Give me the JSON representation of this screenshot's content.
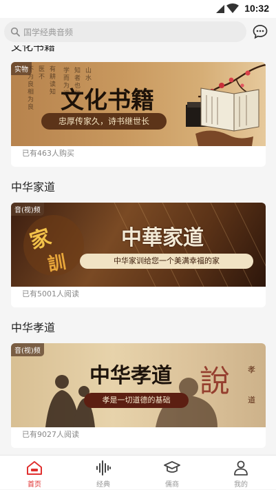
{
  "status_bar": {
    "time": "10:32"
  },
  "search": {
    "placeholder": "国学经典音频"
  },
  "partial_section_title": "文化书籍",
  "cards": [
    {
      "tag": "实物",
      "banner_title": "文化书籍",
      "banner_slogan": "忠厚传家久，诗书继世长",
      "footer": "已有463人购买"
    },
    {
      "section_title": "中华家道",
      "tag": "音(视)频",
      "banner_title": "中華家道",
      "banner_slogan": "中华家训给您一个美满幸福的家",
      "footer": "已有5001人阅读"
    },
    {
      "section_title": "中华孝道",
      "tag": "音(视)频",
      "banner_title": "中华孝道",
      "banner_slogan": "孝是一切道德的基础",
      "footer": "已有9027人阅读"
    }
  ],
  "tab_bar": [
    {
      "label": "首页",
      "icon": "home-icon",
      "active": true
    },
    {
      "label": "经典",
      "icon": "audio-wave-icon",
      "active": false
    },
    {
      "label": "儒商",
      "icon": "graduation-cap-icon",
      "active": false
    },
    {
      "label": "我的",
      "icon": "user-icon",
      "active": false
    }
  ],
  "colors": {
    "accent": "#e0302f",
    "inactive": "#999999"
  }
}
